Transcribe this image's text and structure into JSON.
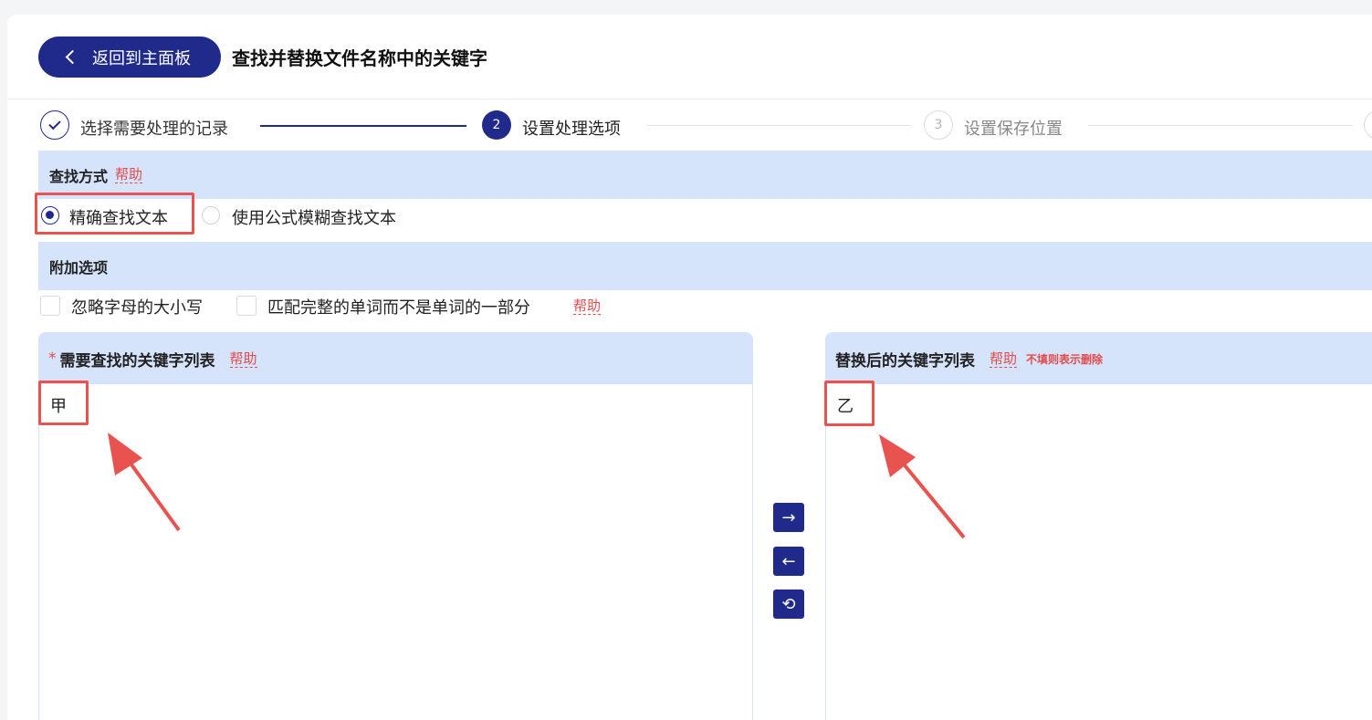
{
  "header": {
    "back_label": "返回到主面板",
    "title": "查找并替换文件名称中的关键字"
  },
  "stepper": {
    "steps": [
      {
        "number": "",
        "label": "选择需要处理的记录",
        "state": "done"
      },
      {
        "number": "2",
        "label": "设置处理选项",
        "state": "active"
      },
      {
        "number": "3",
        "label": "设置保存位置",
        "state": "todo"
      }
    ]
  },
  "find_mode": {
    "title": "查找方式",
    "help": "帮助",
    "options": [
      {
        "label": "精确查找文本",
        "selected": true
      },
      {
        "label": "使用公式模糊查找文本",
        "selected": false
      }
    ]
  },
  "extra_options": {
    "title": "附加选项",
    "help": "帮助",
    "checkboxes": [
      {
        "label": "忽略字母的大小写",
        "checked": false
      },
      {
        "label": "匹配完整的单词而不是单词的一部分",
        "checked": false
      }
    ]
  },
  "find_list": {
    "required_mark": "*",
    "title": "需要查找的关键字列表",
    "help": "帮助",
    "value": "甲"
  },
  "replace_list": {
    "title": "替换后的关键字列表",
    "help": "帮助",
    "note": "不填则表示删除",
    "value": "乙"
  },
  "transfer_buttons": {
    "right_icon": "→",
    "left_icon": "←",
    "swap_icon": "⟲"
  },
  "colors": {
    "primary": "#1f2a8a",
    "section_bg": "#d5e3fb",
    "highlight_red": "#e8524f",
    "help_red": "#e34a4a"
  }
}
